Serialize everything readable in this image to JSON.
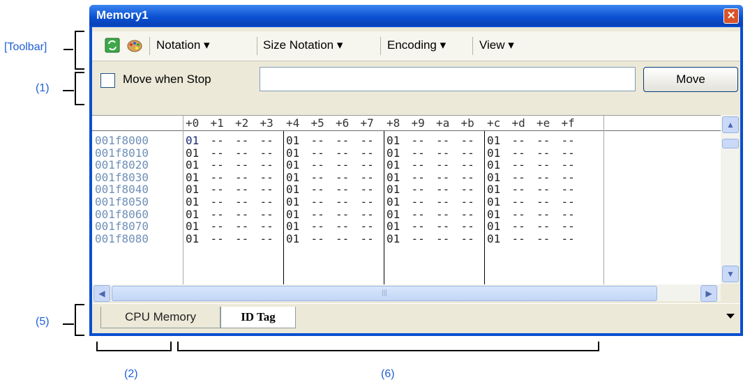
{
  "annotations": {
    "toolbar": "[Toolbar]",
    "one": "(1)",
    "five": "(5)",
    "two": "(2)",
    "six": "(6)"
  },
  "window": {
    "title": "Memory1",
    "close_glyph": "✕"
  },
  "toolbar": {
    "notation": "Notation ▾",
    "size_notation": "Size Notation ▾",
    "encoding": "Encoding ▾",
    "view": "View ▾"
  },
  "bar": {
    "checkbox_label": "Move when Stop",
    "address_value": "",
    "move_label": "Move"
  },
  "grid": {
    "column_headers": [
      "+0",
      "+1",
      "+2",
      "+3",
      "+4",
      "+5",
      "+6",
      "+7",
      "+8",
      "+9",
      "+a",
      "+b",
      "+c",
      "+d",
      "+e",
      "+f"
    ],
    "rows": [
      {
        "address": "001f8000",
        "values": [
          "01",
          "--",
          "--",
          "--",
          "01",
          "--",
          "--",
          "--",
          "01",
          "--",
          "--",
          "--",
          "01",
          "--",
          "--",
          "--"
        ]
      },
      {
        "address": "001f8010",
        "values": [
          "01",
          "--",
          "--",
          "--",
          "01",
          "--",
          "--",
          "--",
          "01",
          "--",
          "--",
          "--",
          "01",
          "--",
          "--",
          "--"
        ]
      },
      {
        "address": "001f8020",
        "values": [
          "01",
          "--",
          "--",
          "--",
          "01",
          "--",
          "--",
          "--",
          "01",
          "--",
          "--",
          "--",
          "01",
          "--",
          "--",
          "--"
        ]
      },
      {
        "address": "001f8030",
        "values": [
          "01",
          "--",
          "--",
          "--",
          "01",
          "--",
          "--",
          "--",
          "01",
          "--",
          "--",
          "--",
          "01",
          "--",
          "--",
          "--"
        ]
      },
      {
        "address": "001f8040",
        "values": [
          "01",
          "--",
          "--",
          "--",
          "01",
          "--",
          "--",
          "--",
          "01",
          "--",
          "--",
          "--",
          "01",
          "--",
          "--",
          "--"
        ]
      },
      {
        "address": "001f8050",
        "values": [
          "01",
          "--",
          "--",
          "--",
          "01",
          "--",
          "--",
          "--",
          "01",
          "--",
          "--",
          "--",
          "01",
          "--",
          "--",
          "--"
        ]
      },
      {
        "address": "001f8060",
        "values": [
          "01",
          "--",
          "--",
          "--",
          "01",
          "--",
          "--",
          "--",
          "01",
          "--",
          "--",
          "--",
          "01",
          "--",
          "--",
          "--"
        ]
      },
      {
        "address": "001f8070",
        "values": [
          "01",
          "--",
          "--",
          "--",
          "01",
          "--",
          "--",
          "--",
          "01",
          "--",
          "--",
          "--",
          "01",
          "--",
          "--",
          "--"
        ]
      },
      {
        "address": "001f8080",
        "values": [
          "01",
          "--",
          "--",
          "--",
          "01",
          "--",
          "--",
          "--",
          "01",
          "--",
          "--",
          "--",
          "01",
          "--",
          "--",
          "--"
        ]
      }
    ]
  },
  "tabs": [
    "CPU Memory",
    "ID Tag"
  ],
  "colors": {
    "accent": "#1f5fd6",
    "titlebar": "#0a4fd1",
    "address": "#6e8fb8"
  },
  "icons": [
    "refresh-icon",
    "palette-icon",
    "close-icon",
    "scroll-up-icon",
    "scroll-down-icon",
    "scroll-left-icon",
    "scroll-right-icon",
    "tab-menu-icon"
  ]
}
